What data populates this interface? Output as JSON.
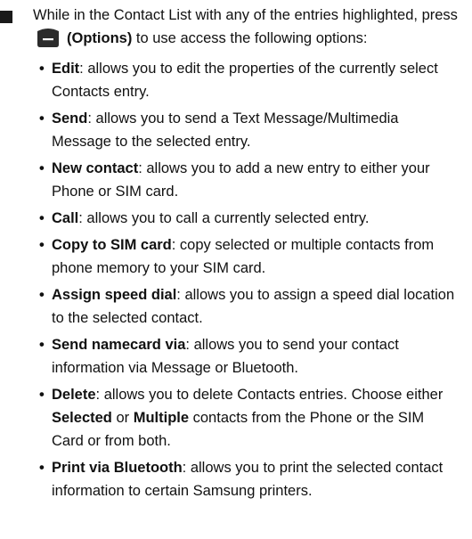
{
  "intro": {
    "before": "While in the Contact List with any of the entries highlighted, press ",
    "options_label": "(Options)",
    "after": " to use access the following options:"
  },
  "softkey_icon": "left-soft-key-icon",
  "items": [
    {
      "term": "Edit",
      "desc": ": allows you to edit the properties of the currently select Contacts entry."
    },
    {
      "term": "Send",
      "desc": ": allows you to send a Text Message/Multimedia Message to the selected entry."
    },
    {
      "term": "New contact",
      "desc": ": allows you to add a new entry to either your Phone or SIM card."
    },
    {
      "term": "Call",
      "desc": ": allows you to call a currently selected entry."
    },
    {
      "term": "Copy to SIM card",
      "desc": ": copy selected or multiple contacts from phone memory to your SIM card."
    },
    {
      "term": "Assign speed dial",
      "desc": ": allows you to assign a speed dial location to the selected contact."
    },
    {
      "term": "Send namecard via",
      "desc": ": allows you to send your contact information via Message or Bluetooth."
    },
    {
      "term": "Delete",
      "desc_a": ": allows you to delete Contacts entries. Choose either ",
      "bold_a": "Selected",
      "mid": " or ",
      "bold_b": "Multiple",
      "desc_b": " contacts from the Phone or the SIM Card or from both."
    },
    {
      "term": "Print via Bluetooth",
      "desc": ": allows you to print the selected contact information to certain Samsung printers."
    }
  ]
}
